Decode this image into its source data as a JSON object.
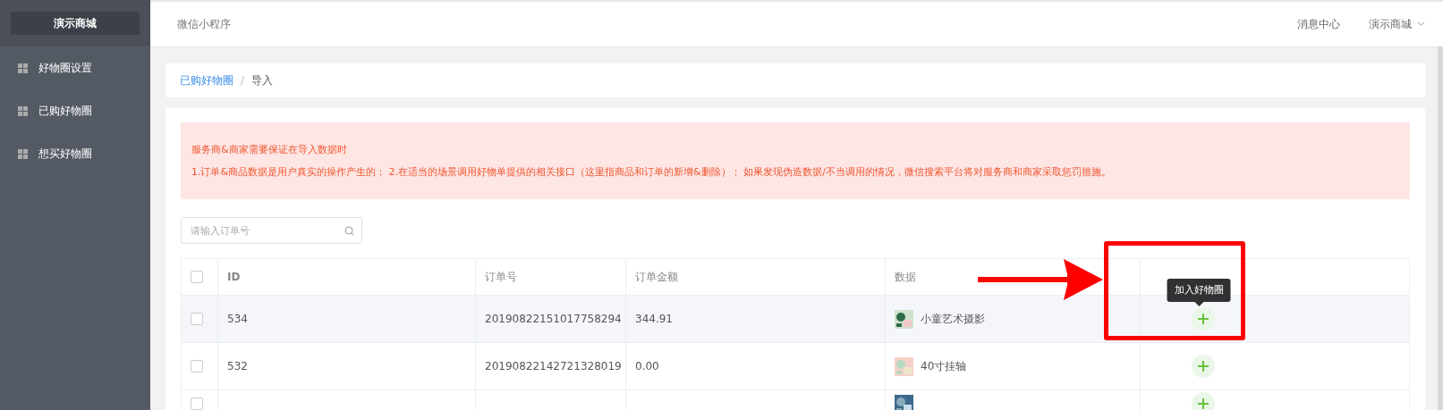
{
  "sidebar": {
    "brand": "演示商城",
    "items": [
      {
        "label": "好物圈设置",
        "selected": false
      },
      {
        "label": "已购好物圈",
        "selected": false
      },
      {
        "label": "想买好物圈",
        "selected": false
      }
    ]
  },
  "header": {
    "title": "微信小程序",
    "links": [
      {
        "label": "消息中心",
        "kind": "link"
      },
      {
        "label": "演示商城",
        "kind": "dropdown"
      }
    ]
  },
  "breadcrumb": {
    "separator": "/",
    "items": [
      {
        "label": "已购好物圈",
        "kind": "link"
      },
      {
        "label": "导入",
        "kind": "current"
      }
    ]
  },
  "alert": {
    "title": "服务商&商家需要保证在导入数据时",
    "body": "1.订单&商品数据是用户真实的操作产生的； 2.在适当的场景调用好物单提供的相关接口（这里指商品和订单的新增&删除）； 如果发现伪造数据/不当调用的情况，微信搜索平台将对服务商和商家采取惩罚措施。"
  },
  "search": {
    "placeholder": "请输入订单号"
  },
  "table": {
    "all_checked": false,
    "columns": [
      "ID",
      "订单号",
      "订单金额",
      "数据"
    ],
    "rows": [
      {
        "checked": false,
        "id": "534",
        "order_no": "20190822151017758294",
        "amount": "344.91",
        "product": "小童艺术摄影",
        "tooltip": "加入好物圈"
      },
      {
        "checked": false,
        "id": "532",
        "order_no": "20190822142721328019",
        "amount": "0.00",
        "product": "40寸挂轴"
      },
      {
        "checked": false
      }
    ]
  },
  "annotation": {
    "highlight_box": true,
    "arrow": true
  }
}
